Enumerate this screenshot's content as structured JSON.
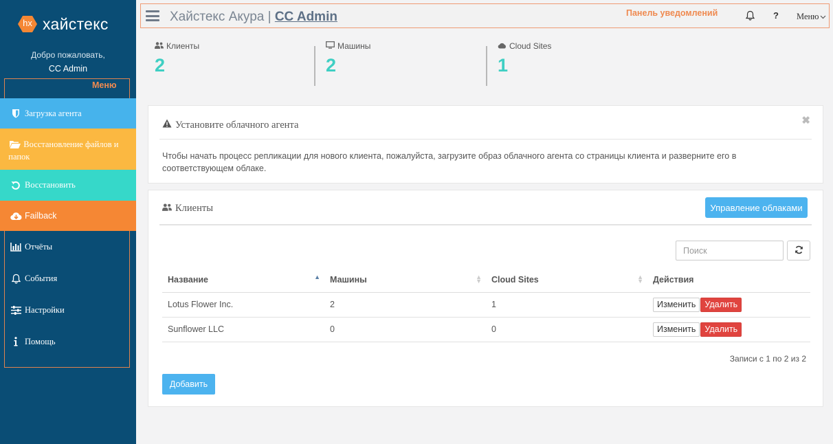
{
  "brand": {
    "badge": "hx",
    "name": "хайстекс"
  },
  "welcome": {
    "greeting": "Добро пожаловать,",
    "user": "CC Admin"
  },
  "annotations": {
    "menu": "Меню",
    "notifications": "Панель уведомлений"
  },
  "sidebar": {
    "items": [
      {
        "label": "Загрузка агента",
        "icon": "shield-icon",
        "color": "#46b3ec"
      },
      {
        "label": "Восстановление файлов и папок",
        "icon": "folder-open-icon",
        "color": "#fbb841"
      },
      {
        "label": "Восстановить",
        "icon": "undo-icon",
        "color": "#36d8c9"
      },
      {
        "label": "Failback",
        "icon": "cloud-download-icon",
        "color": "#f58734"
      },
      {
        "label": "Отчёты",
        "icon": "bar-chart-icon"
      },
      {
        "label": "События",
        "icon": "bell-icon"
      },
      {
        "label": "Настройки",
        "icon": "sliders-icon"
      },
      {
        "label": "Помощь",
        "icon": "info-icon"
      }
    ]
  },
  "header": {
    "title_prefix": "Хайстекс Акура | ",
    "title_admin": "CC Admin",
    "help": "?",
    "menu": "Меню"
  },
  "stats": [
    {
      "label": "Клиенты",
      "value": "2",
      "icon": "users-icon"
    },
    {
      "label": "Машины",
      "value": "2",
      "icon": "monitor-icon"
    },
    {
      "label": "Cloud Sites",
      "value": "1",
      "icon": "cloud-icon"
    }
  ],
  "alert": {
    "title": "Установите облачного агента",
    "close": "✖",
    "body": "Чтобы начать процесс репликации для нового клиента, пожалуйста, загрузите образ облачного агента со страницы клиента и разверните его в соответствующем облаке."
  },
  "clients": {
    "title": "Клиенты",
    "manage_button": "Управление облаками",
    "search_placeholder": "Поиск",
    "columns": [
      "Название",
      "Машины",
      "Cloud Sites",
      "Действия"
    ],
    "rows": [
      {
        "name": "Lotus Flower Inc.",
        "machines": "2",
        "sites": "1",
        "edit": "Изменить",
        "delete": "Удалить"
      },
      {
        "name": "Sunflower LLC",
        "machines": "0",
        "sites": "0",
        "edit": "Изменить",
        "delete": "Удалить"
      }
    ],
    "records_info": "Записи с 1 по 2 из 2",
    "add_button": "Добавить"
  }
}
